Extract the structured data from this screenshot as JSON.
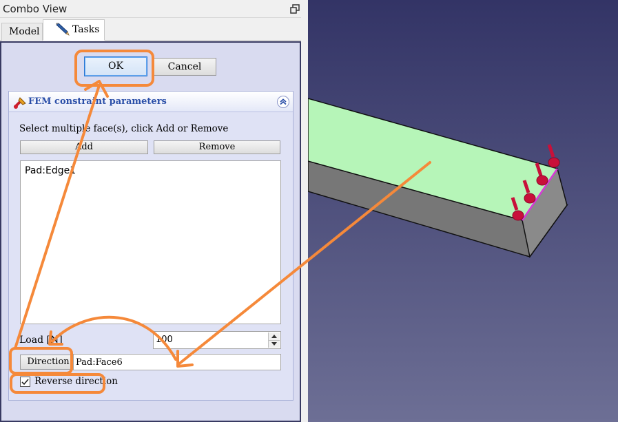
{
  "combo": {
    "title": "Combo View",
    "tabs": [
      {
        "label": "Model"
      },
      {
        "label": "Tasks"
      }
    ]
  },
  "dialog": {
    "ok_label": "OK",
    "cancel_label": "Cancel"
  },
  "fem": {
    "title": "FEM constraint parameters",
    "select_label": "Select multiple face(s), click Add or Remove",
    "add_label": "Add",
    "remove_label": "Remove",
    "items": [
      "Pad:Edge1"
    ],
    "load_label": "Load [N]",
    "load_value": "100",
    "direction_label": "Direction",
    "direction_value": "Pad:Face6",
    "reverse_label": "Reverse direction",
    "reverse_checked": true
  },
  "colors": {
    "viewport_top": "#333466",
    "viewport_bottom": "#6d6f95",
    "face_green": "#b6f5b8",
    "side_gray": "#7a7a7a",
    "arrow_red": "#c8103a",
    "annotation_orange": "#f5893a",
    "title_blue": "#2b4fa8"
  }
}
